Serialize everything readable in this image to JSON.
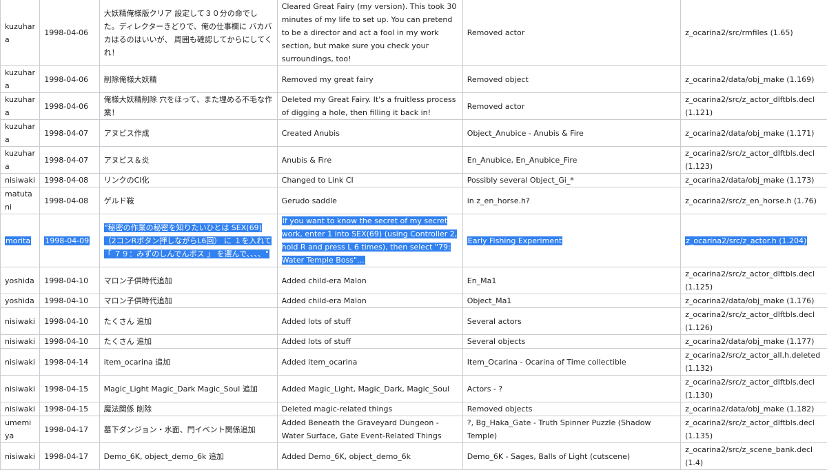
{
  "rows": [
    {
      "author": "kuzuhara",
      "date": "1998-04-06",
      "jp": "大妖精俺様版クリア 設定して３０分の命でした。ディレクターきどりで、俺の仕事欄に バカバカはるのはいいが、 周囲も確認してからにしてくれ！",
      "en": "Cleared Great Fairy (my version). This took 30 minutes of my life to set up. You can pretend to be a director and act a fool in my work section, but make sure you check your surroundings, too!",
      "notes": "Removed actor",
      "file": "z_ocarina2/src/rmfiles (1.65)",
      "h": "h3"
    },
    {
      "author": "kuzuhara",
      "date": "1998-04-06",
      "jp": "削除俺様大妖精",
      "en": "Removed my great fairy",
      "notes": "Removed object",
      "file": "z_ocarina2/data/obj_make (1.169)",
      "h": "h1"
    },
    {
      "author": "kuzuhara",
      "date": "1998-04-06",
      "jp": "俺様大妖精削除 穴をほって、また埋める不毛な作業！",
      "en": "Deleted my Great Fairy. It's a fruitless process of digging a hole, then filling it back in!",
      "notes": "Removed actor",
      "file": "z_ocarina2/src/z_actor_dlftbls.decl (1.121)",
      "h": "h2"
    },
    {
      "author": "kuzuhara",
      "date": "1998-04-07",
      "jp": "アヌビス作成",
      "en": "Created Anubis",
      "notes": "Object_Anubice - Anubis & Fire",
      "file": "z_ocarina2/data/obj_make (1.171)",
      "h": "h1"
    },
    {
      "author": "kuzuhara",
      "date": "1998-04-07",
      "jp": "アヌビス＆炎",
      "en": "Anubis & Fire",
      "notes": "En_Anubice, En_Anubice_Fire",
      "file": "z_ocarina2/src/z_actor_dlftbls.decl (1.123)",
      "h": "h1"
    },
    {
      "author": "nisiwaki",
      "date": "1998-04-08",
      "jp": "リンクのCI化",
      "en": "Changed to Link CI",
      "notes": "Possibly several Object_Gi_*",
      "file": "z_ocarina2/data/obj_make (1.173)",
      "h": "h1"
    },
    {
      "author": "matutani",
      "date": "1998-04-08",
      "jp": "ゲルド鞍",
      "en": "Gerudo saddle",
      "notes": "in z_en_horse.h?",
      "file": "z_ocarina2/src/z_en_horse.h (1.76)",
      "h": "h1"
    },
    {
      "author": "morita",
      "date": "1998-04-09",
      "jp": "\"秘密の作業の秘密を知りたいひとは SEX(69)（2コンRボタン押しながらL6回） に １を入れて 「 ７９：みずのしんでんボス 」 を選んで、、、、\"",
      "en": "If you want to know the secret of my secret work, enter 1 into SEX(69) (using Controller 2, hold R and press L 6 times), then select \"79: Water Temple Boss\"...",
      "notes": "Early Fishing Experiment",
      "file": "z_ocarina2/src/z_actor.h (1.204)",
      "h": "h4",
      "selected": true
    },
    {
      "author": "yoshida",
      "date": "1998-04-10",
      "jp": "マロン子供時代追加",
      "en": "Added child-era Malon",
      "notes": "En_Ma1",
      "file": "z_ocarina2/src/z_actor_dlftbls.decl (1.125)",
      "h": "h1"
    },
    {
      "author": "yoshida",
      "date": "1998-04-10",
      "jp": "マロン子供時代追加",
      "en": "Added child-era Malon",
      "notes": "Object_Ma1",
      "file": "z_ocarina2/data/obj_make (1.176)",
      "h": "h1"
    },
    {
      "author": "nisiwaki",
      "date": "1998-04-10",
      "jp": "たくさん 追加",
      "en": "Added lots of stuff",
      "notes": "Several actors",
      "file": "z_ocarina2/src/z_actor_dlftbls.decl (1.126)",
      "h": "h1"
    },
    {
      "author": "nisiwaki",
      "date": "1998-04-10",
      "jp": "たくさん 追加",
      "en": "Added lots of stuff",
      "notes": "Several objects",
      "file": "z_ocarina2/data/obj_make (1.177)",
      "h": "h1"
    },
    {
      "author": "nisiwaki",
      "date": "1998-04-14",
      "jp": "item_ocarina 追加",
      "en": "Added item_ocarina",
      "notes": "Item_Ocarina - Ocarina of Time collectible",
      "file": "z_ocarina2/src/z_actor_all.h.deleted (1.132)",
      "h": "h1"
    },
    {
      "author": "nisiwaki",
      "date": "1998-04-15",
      "jp": "Magic_Light Magic_Dark Magic_Soul 追加",
      "en": "Added Magic_Light, Magic_Dark, Magic_Soul",
      "notes": "Actors - ?",
      "file": "z_ocarina2/src/z_actor_dlftbls.decl (1.130)",
      "h": "h1"
    },
    {
      "author": "nisiwaki",
      "date": "1998-04-15",
      "jp": "魔法関係 削除",
      "en": "Deleted magic-related things",
      "notes": "Removed objects",
      "file": "z_ocarina2/data/obj_make (1.182)",
      "h": "h1"
    },
    {
      "author": "umemiya",
      "date": "1998-04-17",
      "jp": "墓下ダンジョン・水面、門イベント関係追加",
      "en": "Added Beneath the Graveyard Dungeon - Water Surface, Gate Event-Related Things",
      "notes": "?, Bg_Haka_Gate - Truth Spinner Puzzle (Shadow Temple)",
      "file": "z_ocarina2/src/z_actor_dlftbls.decl (1.135)",
      "h": "h2"
    },
    {
      "author": "nisiwaki",
      "date": "1998-04-17",
      "jp": "Demo_6K, object_demo_6k 追加",
      "en": "Added Demo_6K, object_demo_6k",
      "notes": "Demo_6K - Sages, Balls of Light (cutscene)",
      "file": "z_ocarina2/src/z_scene_bank.decl (1.4)",
      "h": "h1"
    }
  ]
}
